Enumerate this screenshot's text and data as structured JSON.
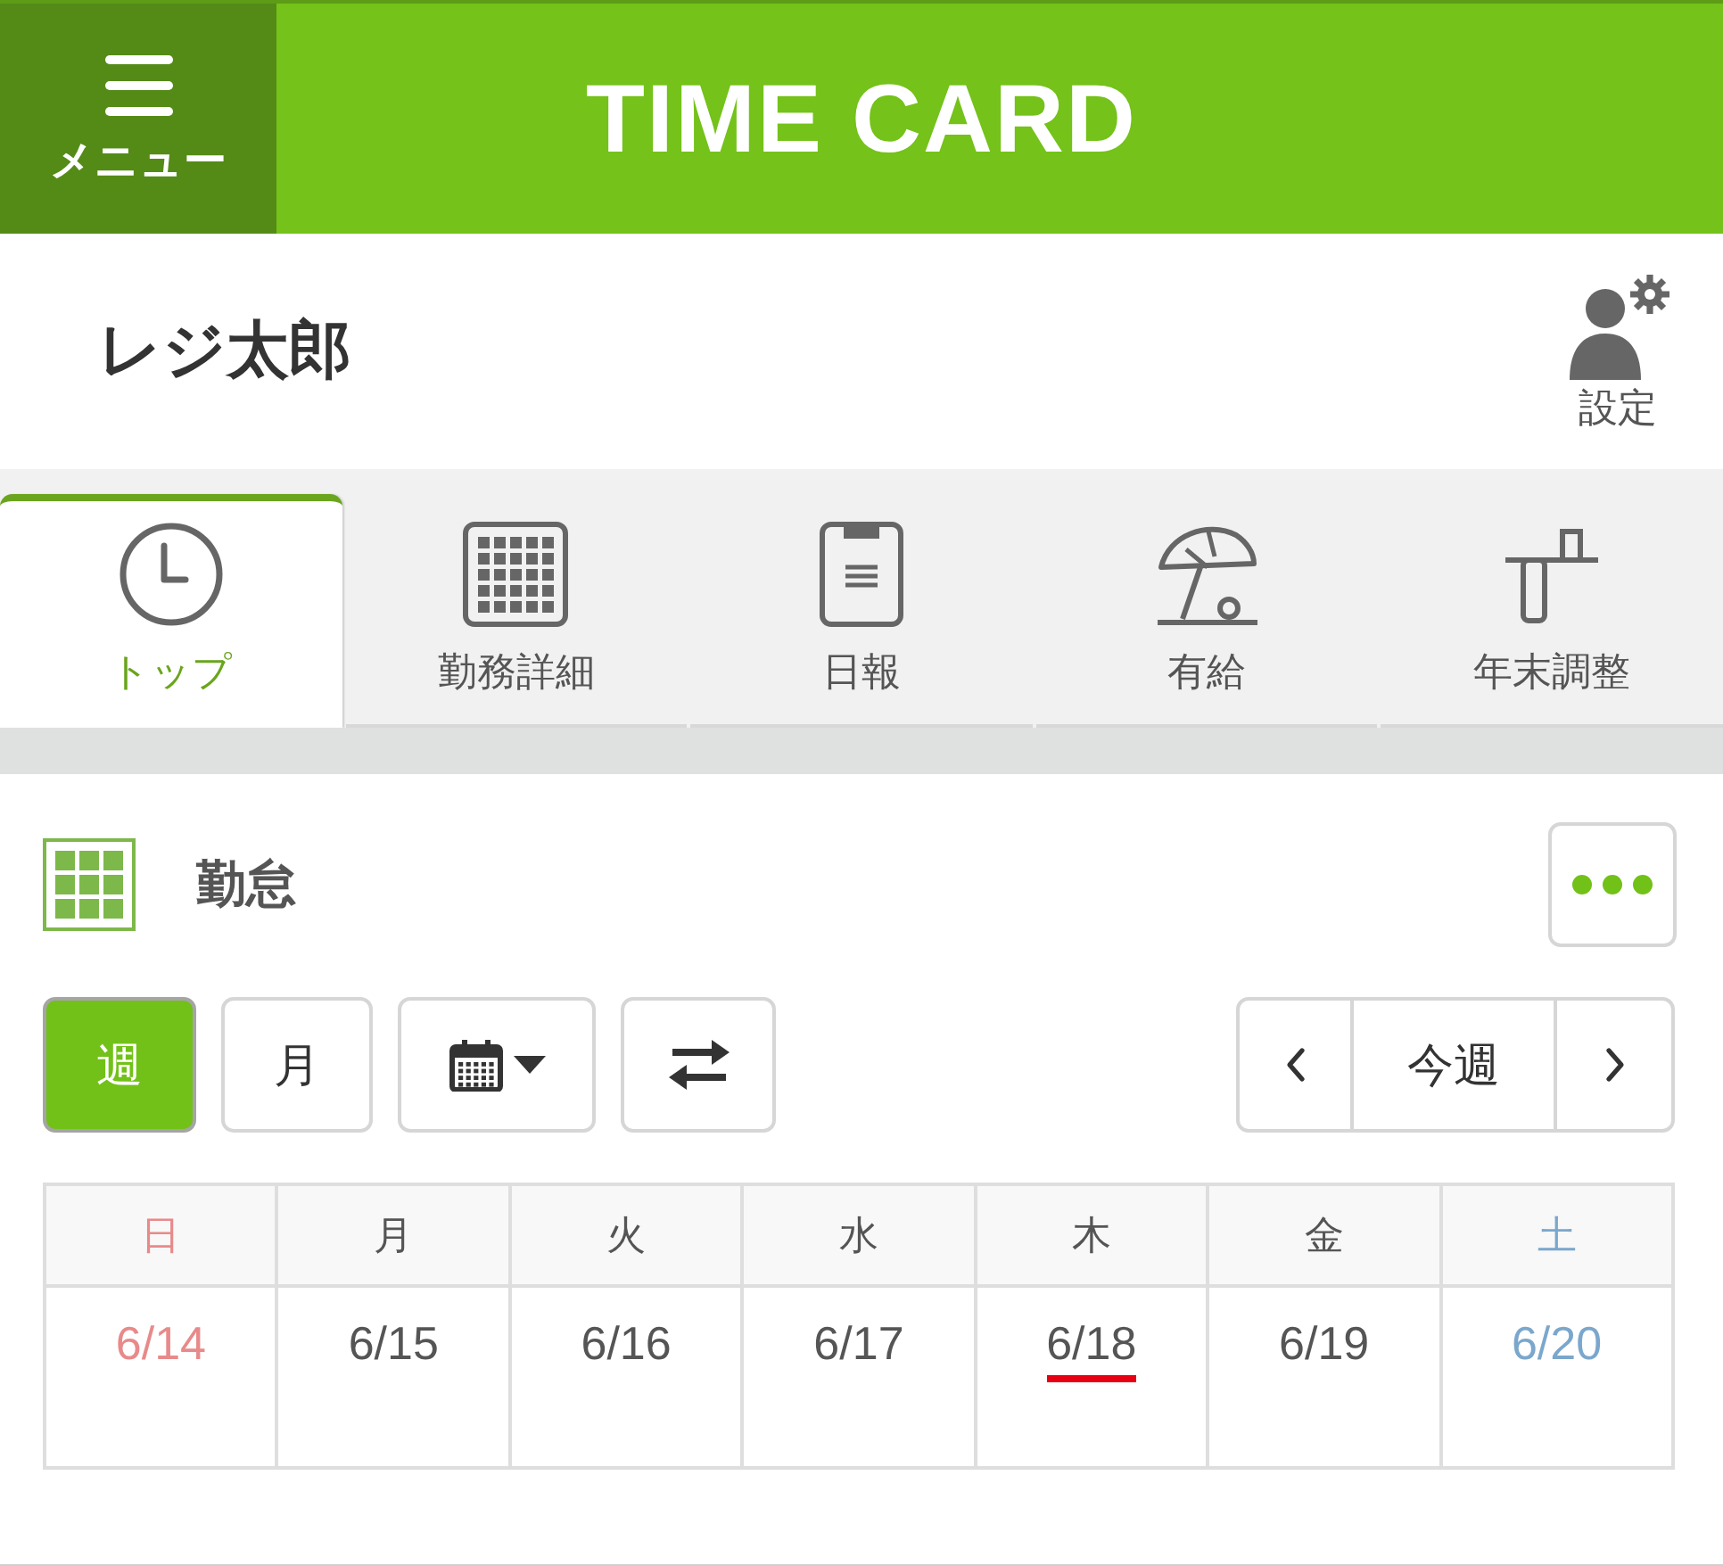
{
  "header": {
    "menu_label": "メニュー",
    "title": "TIME CARD"
  },
  "user": {
    "name": "レジ太郎",
    "settings_label": "設定"
  },
  "tabs": [
    {
      "label": "トップ",
      "selected": true
    },
    {
      "label": "勤務詳細",
      "selected": false
    },
    {
      "label": "日報",
      "selected": false
    },
    {
      "label": "有給",
      "selected": false
    },
    {
      "label": "年末調整",
      "selected": false
    }
  ],
  "section": {
    "title": "勤怠"
  },
  "toolbar": {
    "views": [
      {
        "label": "週",
        "selected": true
      },
      {
        "label": "月",
        "selected": false
      }
    ],
    "period_label": "今週"
  },
  "calendar": {
    "days": [
      {
        "weekday": "日",
        "date": "6/14",
        "kind": "sunday",
        "today": false
      },
      {
        "weekday": "月",
        "date": "6/15",
        "kind": "weekday",
        "today": false
      },
      {
        "weekday": "火",
        "date": "6/16",
        "kind": "weekday",
        "today": false
      },
      {
        "weekday": "水",
        "date": "6/17",
        "kind": "weekday",
        "today": false
      },
      {
        "weekday": "木",
        "date": "6/18",
        "kind": "weekday",
        "today": true
      },
      {
        "weekday": "金",
        "date": "6/19",
        "kind": "weekday",
        "today": false
      },
      {
        "weekday": "土",
        "date": "6/20",
        "kind": "saturday",
        "today": false
      }
    ]
  }
}
